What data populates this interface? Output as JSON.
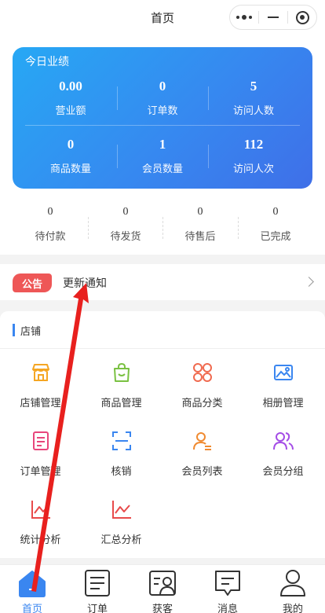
{
  "nav": {
    "title": "首页"
  },
  "stats": {
    "title": "今日业绩",
    "items": [
      {
        "value": "0.00",
        "label": "营业额"
      },
      {
        "value": "0",
        "label": "订单数"
      },
      {
        "value": "5",
        "label": "访问人数"
      },
      {
        "value": "0",
        "label": "商品数量"
      },
      {
        "value": "1",
        "label": "会员数量"
      },
      {
        "value": "112",
        "label": "访问人次"
      }
    ]
  },
  "orders": [
    {
      "value": "0",
      "label": "待付款"
    },
    {
      "value": "0",
      "label": "待发货"
    },
    {
      "value": "0",
      "label": "待售后"
    },
    {
      "value": "0",
      "label": "已完成"
    }
  ],
  "notice": {
    "tag": "公告",
    "text": "更新通知"
  },
  "shop": {
    "title": "店铺",
    "items": [
      {
        "label": "店铺管理",
        "icon": "store-icon",
        "color": "#f5a623"
      },
      {
        "label": "商品管理",
        "icon": "shopping-bag-icon",
        "color": "#7ac142"
      },
      {
        "label": "商品分类",
        "icon": "category-icon",
        "color": "#f06a4f"
      },
      {
        "label": "相册管理",
        "icon": "album-icon",
        "color": "#3a86f0"
      },
      {
        "label": "订单管理",
        "icon": "order-doc-icon",
        "color": "#e8467c"
      },
      {
        "label": "核销",
        "icon": "scan-icon",
        "color": "#3a86f0"
      },
      {
        "label": "会员列表",
        "icon": "member-list-icon",
        "color": "#f08a30"
      },
      {
        "label": "会员分组",
        "icon": "member-group-icon",
        "color": "#a44de6"
      },
      {
        "label": "统计分析",
        "icon": "chart-icon",
        "color": "#e84a4a"
      },
      {
        "label": "汇总分析",
        "icon": "summary-chart-icon",
        "color": "#e84a4a"
      }
    ]
  },
  "tabs": [
    {
      "label": "首页",
      "icon": "home-icon"
    },
    {
      "label": "订单",
      "icon": "order-icon"
    },
    {
      "label": "获客",
      "icon": "customer-icon"
    },
    {
      "label": "消息",
      "icon": "message-icon"
    },
    {
      "label": "我的",
      "icon": "profile-icon"
    }
  ],
  "colors": {
    "accent": "#3a86f0",
    "notice_tag": "#ee5757",
    "annotation_arrow": "#e8201e"
  }
}
